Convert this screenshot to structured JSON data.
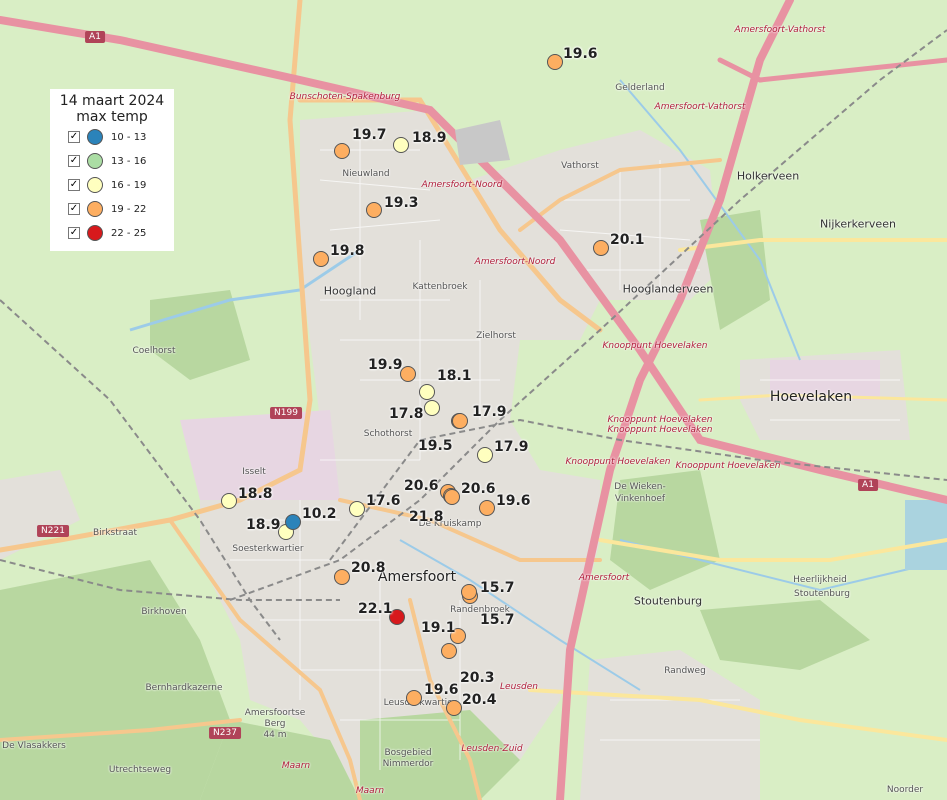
{
  "legend": {
    "title_line1": "14 maart 2024",
    "title_line2": "max temp",
    "check_glyph": "✓",
    "classes": [
      {
        "label": "10 - 13",
        "color": "#2b83ba"
      },
      {
        "label": "13 - 16",
        "color": "#abdda4"
      },
      {
        "label": "16 - 19",
        "color": "#ffffbf"
      },
      {
        "label": "19 - 22",
        "color": "#fdae61"
      },
      {
        "label": "22 - 25",
        "color": "#d7191c"
      }
    ]
  },
  "place_labels": [
    {
      "text": "Amersfoort",
      "kind": "big"
    },
    {
      "text": "Hoogland",
      "kind": "town"
    },
    {
      "text": "Hooglanderveen",
      "kind": "town"
    },
    {
      "text": "Hoevelaken",
      "kind": "big"
    },
    {
      "text": "Holkerveen",
      "kind": "town"
    },
    {
      "text": "Nijkerkerveen",
      "kind": "town"
    },
    {
      "text": "Stoutenburg",
      "kind": "town"
    },
    {
      "text": "Vathorst",
      "kind": "district"
    },
    {
      "text": "Nieuwland",
      "kind": "district"
    },
    {
      "text": "Kattenbroek",
      "kind": "district"
    },
    {
      "text": "Schothorst",
      "kind": "district"
    },
    {
      "text": "De Kruiskamp",
      "kind": "district"
    },
    {
      "text": "Soesterkwartier",
      "kind": "district"
    },
    {
      "text": "Isselt",
      "kind": "district"
    },
    {
      "text": "Randenbroek",
      "kind": "district"
    },
    {
      "text": "Leusderkwartier",
      "kind": "district"
    },
    {
      "text": "De Wieken-",
      "kind": "district"
    },
    {
      "text": "Vinkenhoef",
      "kind": "district"
    },
    {
      "text": "Coelhorst",
      "kind": "district"
    },
    {
      "text": "Birkhoven",
      "kind": "district"
    },
    {
      "text": "Bernhardkazerne",
      "kind": "district"
    },
    {
      "text": "Amersfoortse",
      "kind": "district"
    },
    {
      "text": "Berg",
      "kind": "district"
    },
    {
      "text": "44 m",
      "kind": "district"
    },
    {
      "text": "Bosgebied",
      "kind": "district"
    },
    {
      "text": "Nimmerdor",
      "kind": "district"
    },
    {
      "text": "De Vlasakkers",
      "kind": "district"
    },
    {
      "text": "Heerlijkheid",
      "kind": "district"
    },
    {
      "text": "Stoutenburg",
      "kind": "district"
    },
    {
      "text": "Gelderland",
      "kind": "district"
    },
    {
      "text": "Randweg",
      "kind": "district"
    },
    {
      "text": "Noorder",
      "kind": "district"
    },
    {
      "text": "Birkstraat",
      "kind": "district"
    },
    {
      "text": "Utrechtseweg",
      "kind": "district"
    },
    {
      "text": "Zielhorst",
      "kind": "district"
    }
  ],
  "road_labels": [
    {
      "text": "Bunschoten-Spakenburg"
    },
    {
      "text": "Amersfoort-Noord"
    },
    {
      "text": "Amersfoort-Noord"
    },
    {
      "text": "Amersfoort-Vathorst"
    },
    {
      "text": "Amersfoort-Vathorst"
    },
    {
      "text": "Knooppunt Hoevelaken"
    },
    {
      "text": "Knooppunt Hoevelaken"
    },
    {
      "text": "Knooppunt Hoevelaken"
    },
    {
      "text": "Knooppunt Hoevelaken"
    },
    {
      "text": "Knooppunt Hoevelaken"
    },
    {
      "text": "Amersfoort"
    },
    {
      "text": "Leusden"
    },
    {
      "text": "Leusden-Zuid"
    },
    {
      "text": "Maarn"
    },
    {
      "text": "Maarn"
    }
  ],
  "shields": [
    {
      "text": "A1"
    },
    {
      "text": "A1"
    },
    {
      "text": "N199"
    },
    {
      "text": "N221"
    },
    {
      "text": "N237"
    }
  ],
  "stations": [
    {
      "value": "19.6",
      "class": 3
    },
    {
      "value": "19.7",
      "class": 3
    },
    {
      "value": "18.9",
      "class": 2
    },
    {
      "value": "19.3",
      "class": 3
    },
    {
      "value": "19.8",
      "class": 3
    },
    {
      "value": "20.1",
      "class": 3
    },
    {
      "value": "19.9",
      "class": 3
    },
    {
      "value": "18.1",
      "class": 2
    },
    {
      "value": "17.8",
      "class": 2
    },
    {
      "value": "17.9",
      "class": 3
    },
    {
      "value": "19.5",
      "class": 3
    },
    {
      "value": "17.9",
      "class": 2
    },
    {
      "value": "20.6",
      "class": 3
    },
    {
      "value": "20.6",
      "class": 3
    },
    {
      "value": "21.8",
      "class": 3
    },
    {
      "value": "19.6",
      "class": 3
    },
    {
      "value": "17.6",
      "class": 2
    },
    {
      "value": "18.8",
      "class": 2
    },
    {
      "value": "18.9",
      "class": 2
    },
    {
      "value": "10.2",
      "class": 0
    },
    {
      "value": "20.8",
      "class": 3
    },
    {
      "value": "22.1",
      "class": 4
    },
    {
      "value": "15.7",
      "class": 3
    },
    {
      "value": "15.7",
      "class": 3
    },
    {
      "value": "19.1",
      "class": 3
    },
    {
      "value": "20.3",
      "class": 3
    },
    {
      "value": "19.6",
      "class": 3
    },
    {
      "value": "20.4",
      "class": 3
    }
  ]
}
